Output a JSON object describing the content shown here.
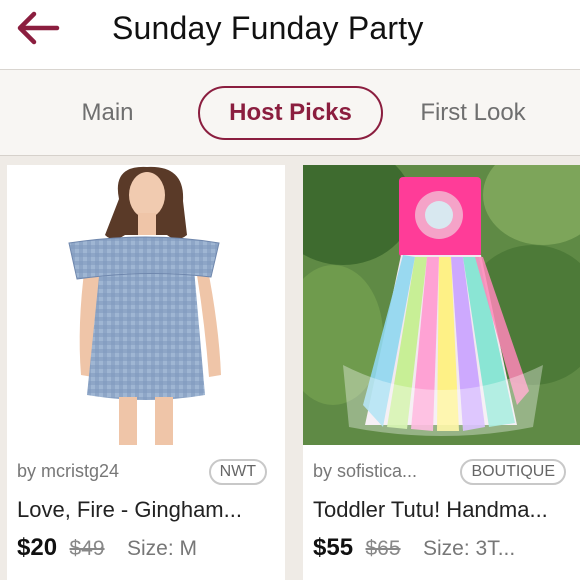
{
  "header": {
    "title": "Sunday Funday Party",
    "back_icon": "arrow-left-icon",
    "accent_color": "#8b1e3f"
  },
  "tabs": [
    {
      "label": "Main",
      "active": false
    },
    {
      "label": "Host Picks",
      "active": true
    },
    {
      "label": "First Look",
      "active": false
    }
  ],
  "listings": [
    {
      "seller": "by mcristg24",
      "badge": "NWT",
      "title": "Love, Fire - Gingham...",
      "price": "$20",
      "original_price": "$49",
      "size": "Size: M"
    },
    {
      "seller": "by sofistica...",
      "badge": "BOUTIQUE",
      "title": "Toddler Tutu! Handma...",
      "price": "$55",
      "original_price": "$65",
      "size": "Size: 3T..."
    }
  ]
}
